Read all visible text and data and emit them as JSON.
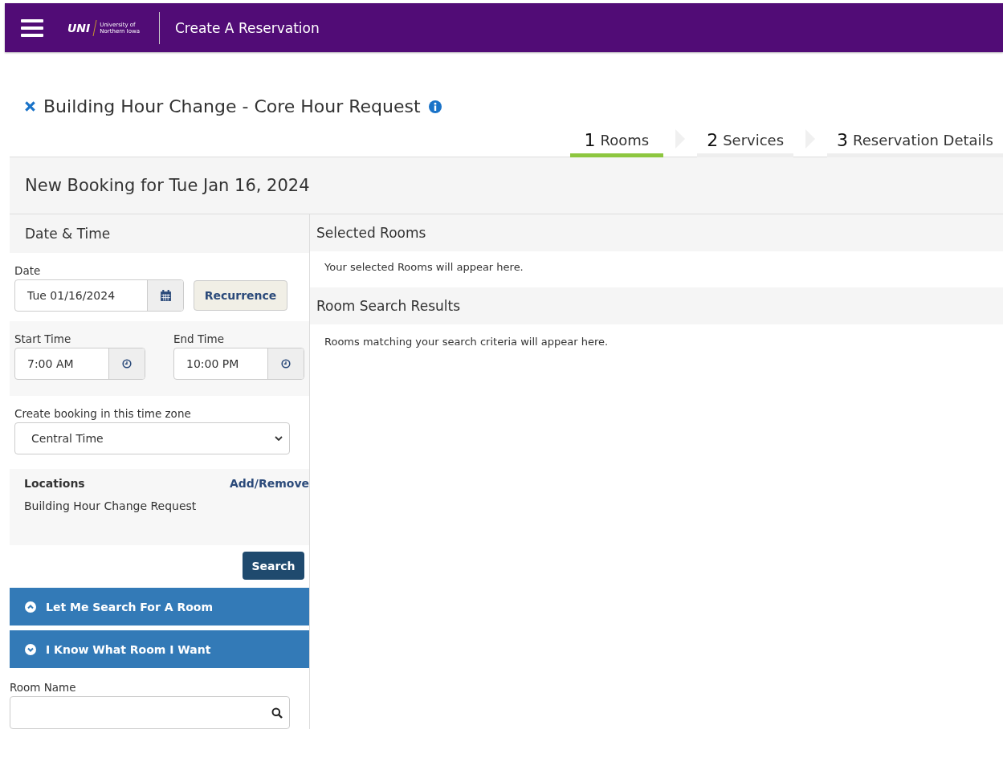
{
  "header": {
    "logo": {
      "mark": "UNI",
      "line_1": "University of",
      "line_2": "Northern Iowa"
    },
    "title": "Create A Reservation"
  },
  "page_title": "Building Hour Change - Core Hour Request",
  "steps": [
    {
      "number": "1",
      "label": "Rooms",
      "selected": true
    },
    {
      "number": "2",
      "label": "Services",
      "selected": false
    },
    {
      "number": "3",
      "label": "Reservation Details",
      "selected": false
    }
  ],
  "booking_title": "New Booking for Tue Jan 16, 2024",
  "date_time": {
    "heading": "Date & Time",
    "date_label": "Date",
    "date_value": "Tue 01/16/2024",
    "recurrence_button": "Recurrence",
    "start_label": "Start Time",
    "start_value": "7:00 AM",
    "end_label": "End Time",
    "end_value": "10:00 PM",
    "timezone_label": "Create booking in this time zone",
    "timezone_value": "Central Time"
  },
  "locations": {
    "heading": "Locations",
    "action": "Add/Remove",
    "items": [
      "Building Hour Change Request"
    ]
  },
  "search_button": "Search",
  "accordions": [
    {
      "label": "Let Me Search For A Room",
      "expanded": true
    },
    {
      "label": "I Know What Room I Want",
      "expanded": false
    }
  ],
  "room_name": {
    "label": "Room Name"
  },
  "selected_rooms": {
    "heading": "Selected Rooms",
    "message": "Your selected Rooms will appear here."
  },
  "results": {
    "heading": "Room Search Results",
    "message": "Rooms matching your search criteria will appear here."
  }
}
